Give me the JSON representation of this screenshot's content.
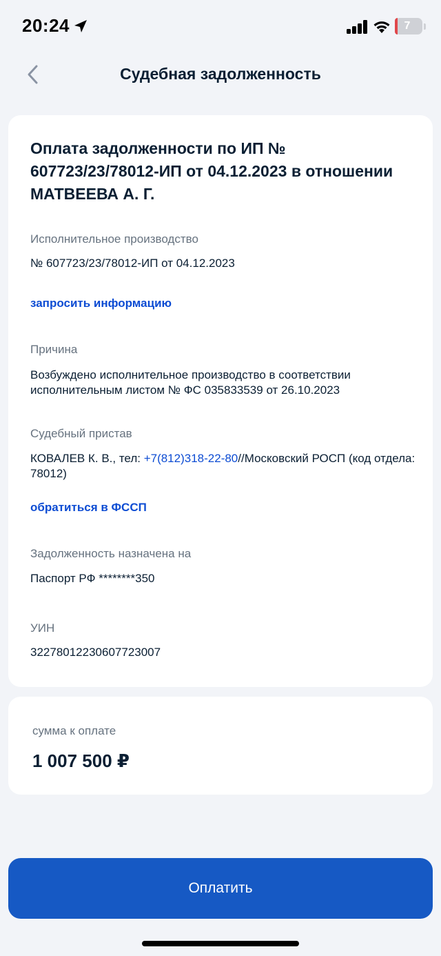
{
  "status_bar": {
    "time": "20:24",
    "battery": "7",
    "icons": [
      "location-arrow-icon",
      "signal-icon",
      "wifi-icon",
      "battery-icon"
    ]
  },
  "header": {
    "title": "Судебная задолженность",
    "back_icon": "chevron-left-icon"
  },
  "debt": {
    "heading": "Оплата задолженности по ИП № 607723/23/78012-ИП от 04.12.2023 в отношении МАТВЕЕВА А. Г.",
    "proceeding_label": "Исполнительное производство",
    "proceeding_value": "№ 607723/23/78012-ИП от 04.12.2023",
    "request_info_link": "запросить информацию",
    "reason_label": "Причина",
    "reason_value": "Возбуждено исполнительное производство в соответствии исполнительным листом № ФС 035833539 от 26.10.2023",
    "bailiff_label": "Судебный пристав",
    "bailiff_name": "КОВАЛЕВ К. В., тел: ",
    "bailiff_phone": "+7(812)318-22-80",
    "bailiff_dept": "//Московский РОСП (код отдела: 78012)",
    "contact_fssp_link": "обратиться в ФССП",
    "assigned_label": "Задолженность назначена на",
    "assigned_value": "Паспорт РФ ********350",
    "uin_label": "УИН",
    "uin_value": "32278012230607723007"
  },
  "payment": {
    "sum_label": "сумма к оплате",
    "sum_value": "1 007 500 ₽",
    "pay_button": "Оплатить"
  },
  "colors": {
    "accent": "#0d4cd3",
    "button": "#1659c4",
    "background": "#f2f4f8",
    "muted_text": "#66727f",
    "text": "#0b1f33"
  }
}
